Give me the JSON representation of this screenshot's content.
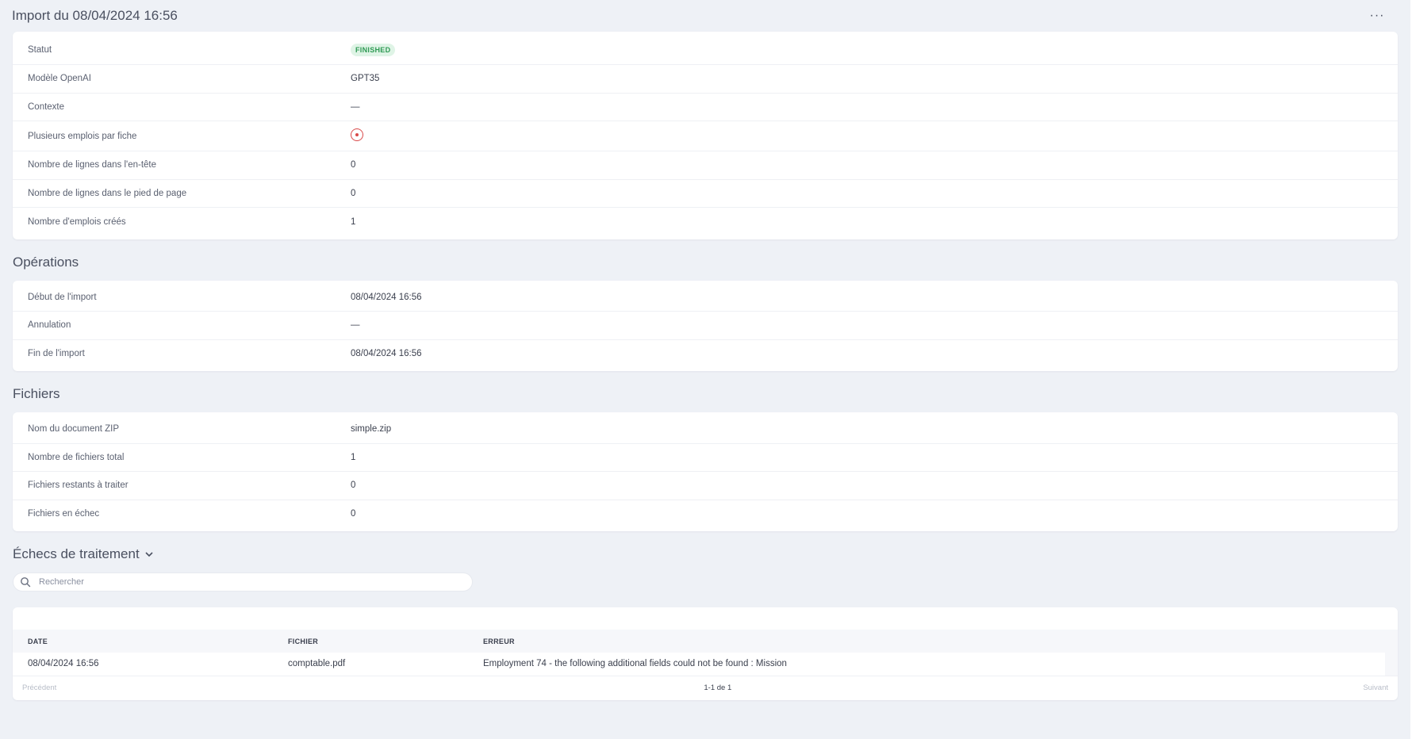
{
  "header": {
    "title": "Import du 08/04/2024 16:56",
    "more_label": "···"
  },
  "details": [
    {
      "label": "Statut",
      "value": "FINISHED",
      "type": "badge"
    },
    {
      "label": "Modèle OpenAI",
      "value": "GPT35"
    },
    {
      "label": "Contexte",
      "value": "—"
    },
    {
      "label": "Plusieurs emplois par fiche",
      "value": "",
      "type": "no-icon"
    },
    {
      "label": "Nombre de lignes dans l'en-tête",
      "value": "0"
    },
    {
      "label": "Nombre de lignes dans le pied de page",
      "value": "0"
    },
    {
      "label": "Nombre d'emplois créés",
      "value": "1"
    }
  ],
  "operations": {
    "title": "Opérations",
    "rows": [
      {
        "label": "Début de l'import",
        "value": "08/04/2024 16:56"
      },
      {
        "label": "Annulation",
        "value": "—"
      },
      {
        "label": "Fin de l'import",
        "value": "08/04/2024 16:56"
      }
    ]
  },
  "files": {
    "title": "Fichiers",
    "rows": [
      {
        "label": "Nom du document ZIP",
        "value": "simple.zip"
      },
      {
        "label": "Nombre de fichiers total",
        "value": "1"
      },
      {
        "label": "Fichiers restants à traiter",
        "value": "0"
      },
      {
        "label": "Fichiers en échec",
        "value": "0"
      }
    ]
  },
  "failures": {
    "title": "Échecs de traitement",
    "search_placeholder": "Rechercher",
    "columns": [
      "DATE",
      "FICHIER",
      "ERREUR"
    ],
    "rows": [
      {
        "date": "08/04/2024 16:56",
        "file": "comptable.pdf",
        "error": "Employment 74 - the following additional fields could not be found : Mission"
      }
    ],
    "pager": {
      "prev": "Précédent",
      "count": "1-1 de 1",
      "next": "Suivant"
    }
  },
  "colors": {
    "background": "#eef1f6",
    "card": "#ffffff",
    "badge_bg": "#dff4e6",
    "badge_text": "#2f9a54",
    "no_icon": "#d94a4a"
  }
}
